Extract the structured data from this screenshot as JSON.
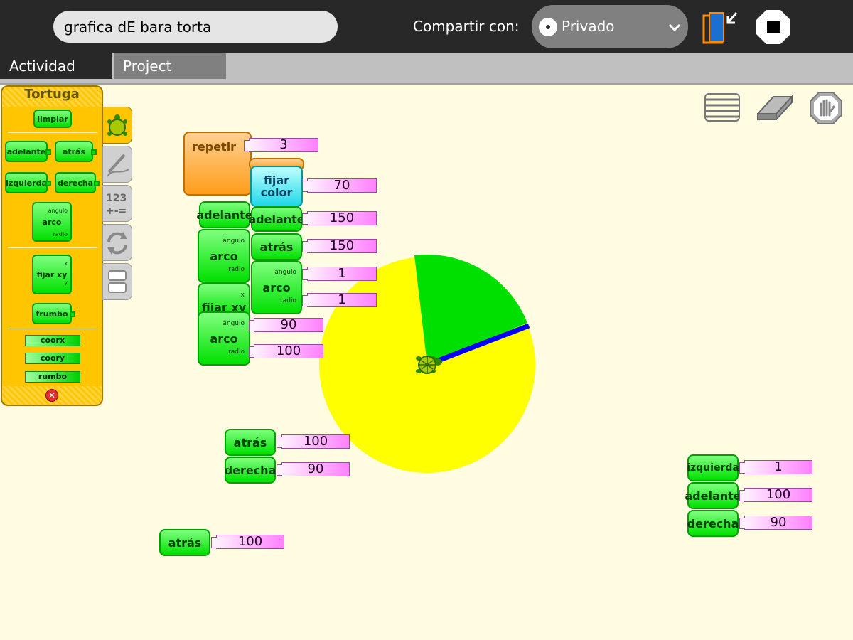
{
  "toolbar": {
    "title_value": "grafica dE bara torta",
    "share_label": "Compartir con:",
    "share_value": "Privado"
  },
  "tabs": {
    "activity": "Actividad",
    "project": "Project"
  },
  "palette": {
    "title": "Tortuga",
    "blocks": {
      "clean": "limpiar",
      "forward": "adelante",
      "back": "atrás",
      "left": "izquierda",
      "right": "derecha",
      "arc": "arco",
      "arc_angle": "ángulo",
      "arc_radius": "radio",
      "setxy": "fijar xy",
      "setxy_x": "x",
      "setxy_y": "y",
      "seth": "frumbo",
      "xcor": "coorx",
      "ycor": "coory",
      "heading": "rumbo"
    }
  },
  "canvas": {
    "repeat": {
      "label": "repetir",
      "count": "3"
    },
    "setcolor": {
      "line1": "fijar",
      "line2": "color",
      "value": "70"
    },
    "col1": {
      "forward": "adelante",
      "arc": "arco",
      "arc_angle": "ángulo",
      "arc_radius": "radio",
      "setxy": "fijar xy",
      "setxy_x": "x",
      "arc2": "arco",
      "arc2_angle": "ángulo",
      "arc2_radius": "radio",
      "arc2_angle_val": "90",
      "arc2_radius_val": "100"
    },
    "col2": {
      "forward": "adelante",
      "forward_val": "150",
      "back": "atrás",
      "back_val": "150",
      "arc": "arco",
      "arc_angle": "ángulo",
      "arc_radius": "radio",
      "arc_angle_val": "1",
      "arc_radius_val": "1"
    },
    "stack_mid": {
      "back": "atrás",
      "back_val": "100",
      "right": "derecha",
      "right_val": "90"
    },
    "stack_low": {
      "back": "atrás",
      "back_val": "100"
    },
    "stack_right": {
      "left": "izquierda",
      "left_val": "1",
      "forward": "adelante",
      "forward_val": "100",
      "right": "derecha",
      "right_val": "90"
    }
  },
  "colors": {
    "pie_yellow": "#ffff00",
    "pie_green": "#00e000",
    "pie_blue": "#0000ff",
    "block_green": "#00e000",
    "palette_bg": "#ffc600",
    "canvas_bg": "#fffce1"
  },
  "icons": {
    "share_dot": "radio-dot-icon",
    "chevron": "chevron-down-icon",
    "keep": "journal-keep-icon",
    "stop": "stop-icon",
    "turtle": "turtle-icon",
    "pen": "pen-icon",
    "numbers": "numbers-icon",
    "flow": "flow-icon",
    "blocks": "blocks-icon",
    "hide": "hide-blocks-icon",
    "eraser": "eraser-icon",
    "stop_hand": "stop-hand-icon"
  }
}
